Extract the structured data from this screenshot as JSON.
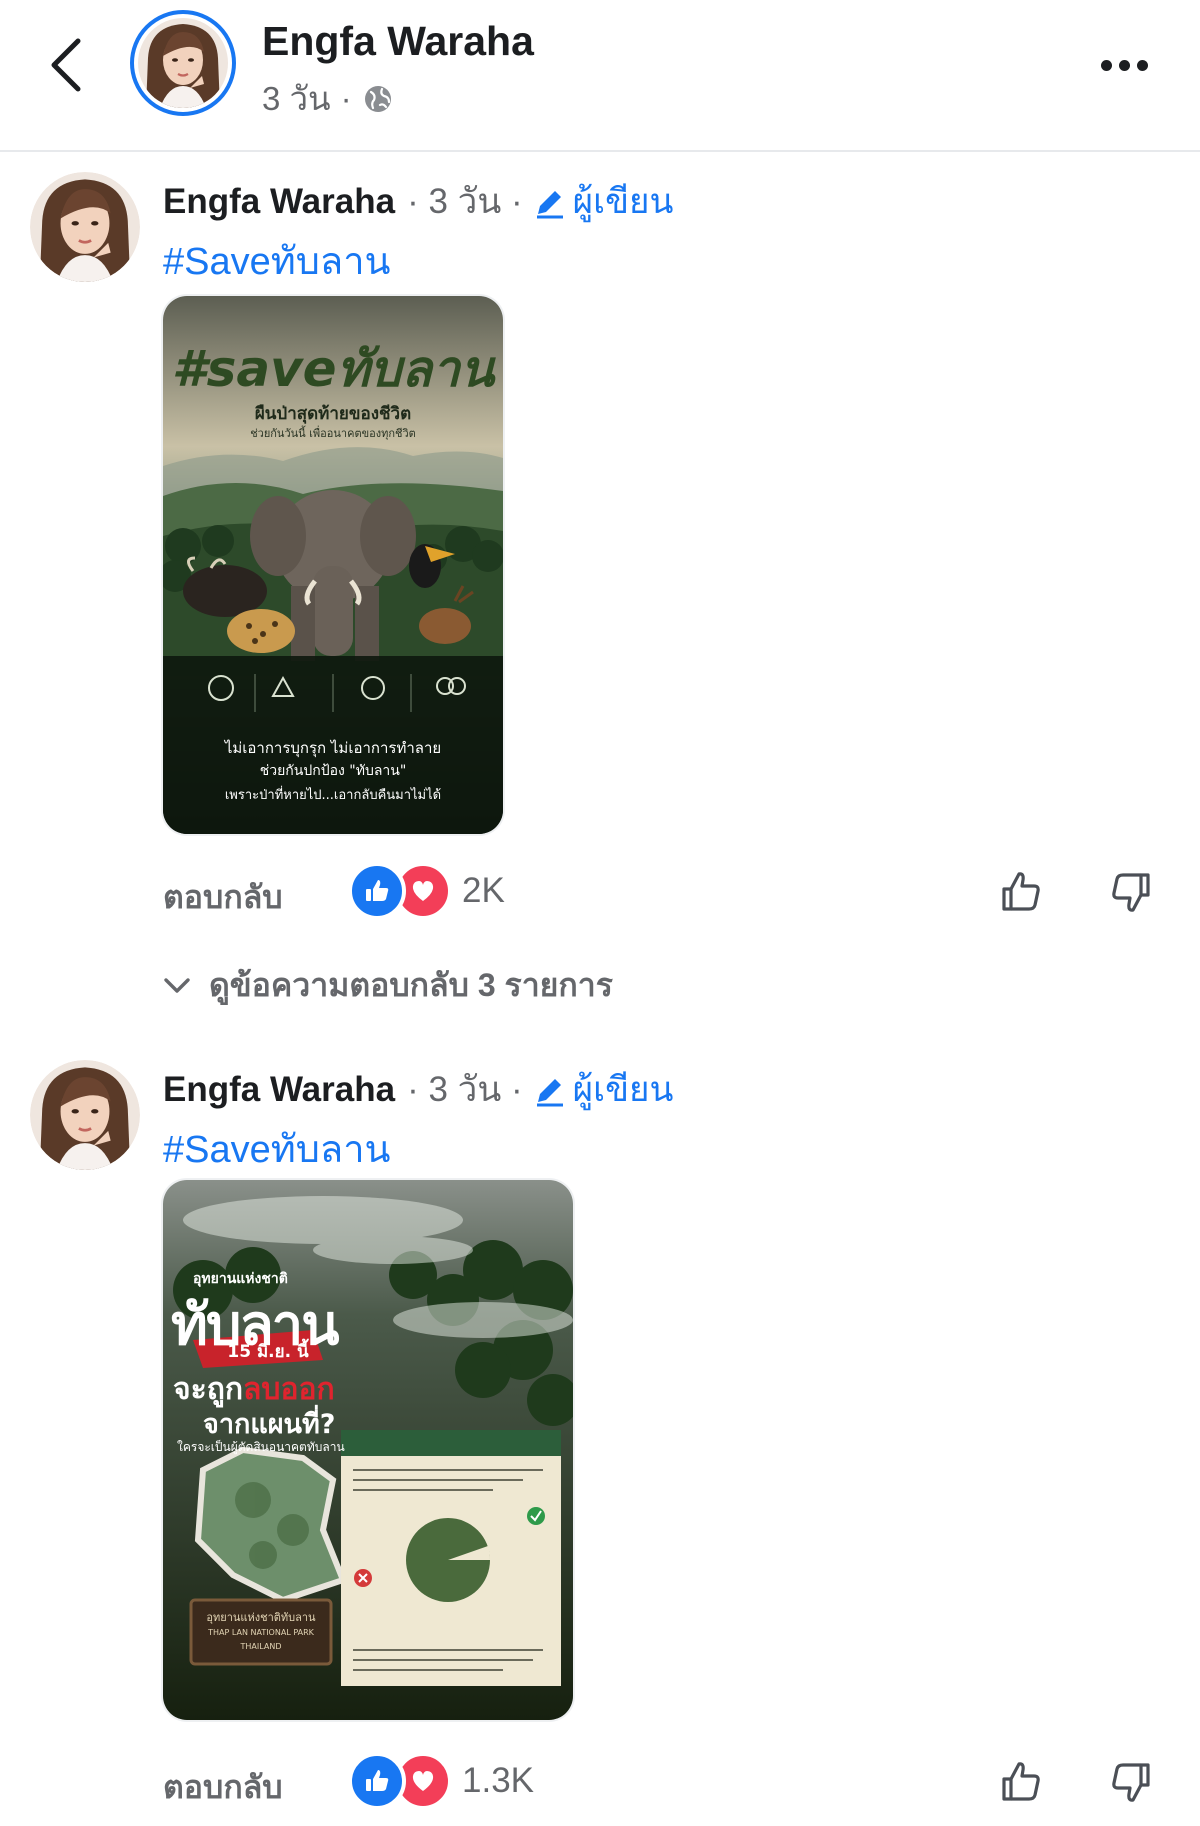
{
  "header": {
    "author_name": "Engfa Waraha",
    "time": "3 วัน",
    "separator": "·",
    "privacy_icon": "globe-icon"
  },
  "comments": [
    {
      "author_name": "Engfa Waraha",
      "time": "· 3 วัน ·",
      "author_badge": "ผู้เขียน",
      "hashtag": "#Saveทับลาน",
      "reply_label": "ตอบกลับ",
      "reaction_count": "2K",
      "reactions": [
        "like",
        "love"
      ],
      "view_replies": "ดูข้อความตอบกลับ 3 รายการ",
      "poster": {
        "headline_latin": "#save",
        "headline_thai": "ทับลาน",
        "subtitle_1": "ผืนป่าสุดท้ายของชีวิต",
        "subtitle_2": "ช่วยกันวันนี้ เพื่ออนาคตของทุกชีวิต",
        "footer_1": "ไม่เอาการบุกรุก ไม่เอาการทำลาย",
        "footer_2": "ช่วยกันปกป้อง \"ทับลาน\"",
        "footer_3": "เพราะป่าที่หายไป...เอากลับคืนมาไม่ได้"
      }
    },
    {
      "author_name": "Engfa Waraha",
      "time": "· 3 วัน ·",
      "author_badge": "ผู้เขียน",
      "hashtag": "#Saveทับลาน",
      "reply_label": "ตอบกลับ",
      "reaction_count": "1.3K",
      "reactions": [
        "like",
        "love"
      ],
      "poster": {
        "kicker": "อุทยานแห่งชาติ",
        "headline": "ทับลาน",
        "date_banner": "15 มิ.ย. นี้",
        "line_1_a": "จะถูก",
        "line_1_b": "ลบออก",
        "line_2": "จากแผนที่?",
        "line_3": "ใครจะเป็นผู้ตัดสินอนาคตทับลาน",
        "sign_1": "อุทยานแห่งชาติทับลาน",
        "sign_2": "THAP LAN NATIONAL PARK",
        "sign_3": "THAILAND"
      }
    }
  ],
  "colors": {
    "link_blue": "#1877f2",
    "meta_gray": "#65676b",
    "love_red": "#f33e58"
  }
}
